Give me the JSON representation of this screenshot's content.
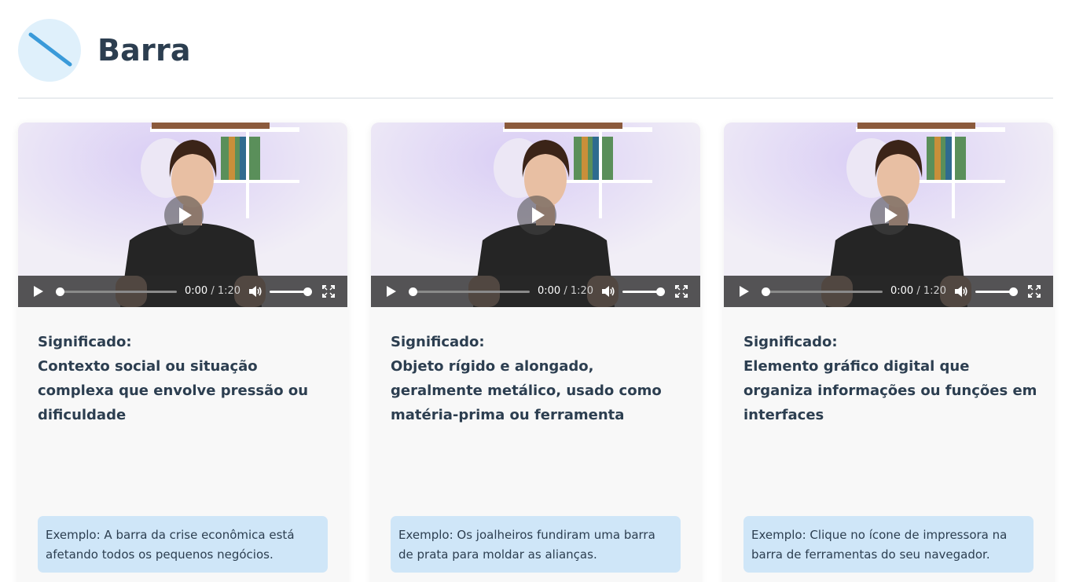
{
  "page": {
    "title": "Barra",
    "logo_icon": "slash-icon",
    "logo_color": "#3a9ad9",
    "logo_bg": "#dff0fb"
  },
  "cards": [
    {
      "video": {
        "current_time": "0:00",
        "separator": " / ",
        "duration": "1:20",
        "progress": 0,
        "volume": 1
      },
      "meaning_label": "Significado:",
      "meaning_text": "Contexto social ou situação complexa que envolve pressão ou dificuldade",
      "example": "Exemplo: A barra da crise econômica está afetando todos os pequenos negócios."
    },
    {
      "video": {
        "current_time": "0:00",
        "separator": " / ",
        "duration": "1:20",
        "progress": 0,
        "volume": 1
      },
      "meaning_label": "Significado:",
      "meaning_text": "Objeto rígido e alongado, geralmente metálico, usado como matéria-prima ou ferramenta",
      "example": "Exemplo: Os joalheiros fundiram uma barra de prata para moldar as alianças."
    },
    {
      "video": {
        "current_time": "0:00",
        "separator": " / ",
        "duration": "1:20",
        "progress": 0,
        "volume": 1
      },
      "meaning_label": "Significado:",
      "meaning_text": "Elemento gráfico digital que organiza informações ou funções em interfaces",
      "example": "Exemplo: Clique no ícone de impressora na barra de ferramentas do seu navegador."
    }
  ],
  "icons": {
    "play": "play-icon",
    "volume": "volume-icon",
    "fullscreen": "fullscreen-icon"
  },
  "colors": {
    "example_bg": "#cfe6f8",
    "card_bg": "#f8f8f8",
    "text": "#2c3e50"
  }
}
